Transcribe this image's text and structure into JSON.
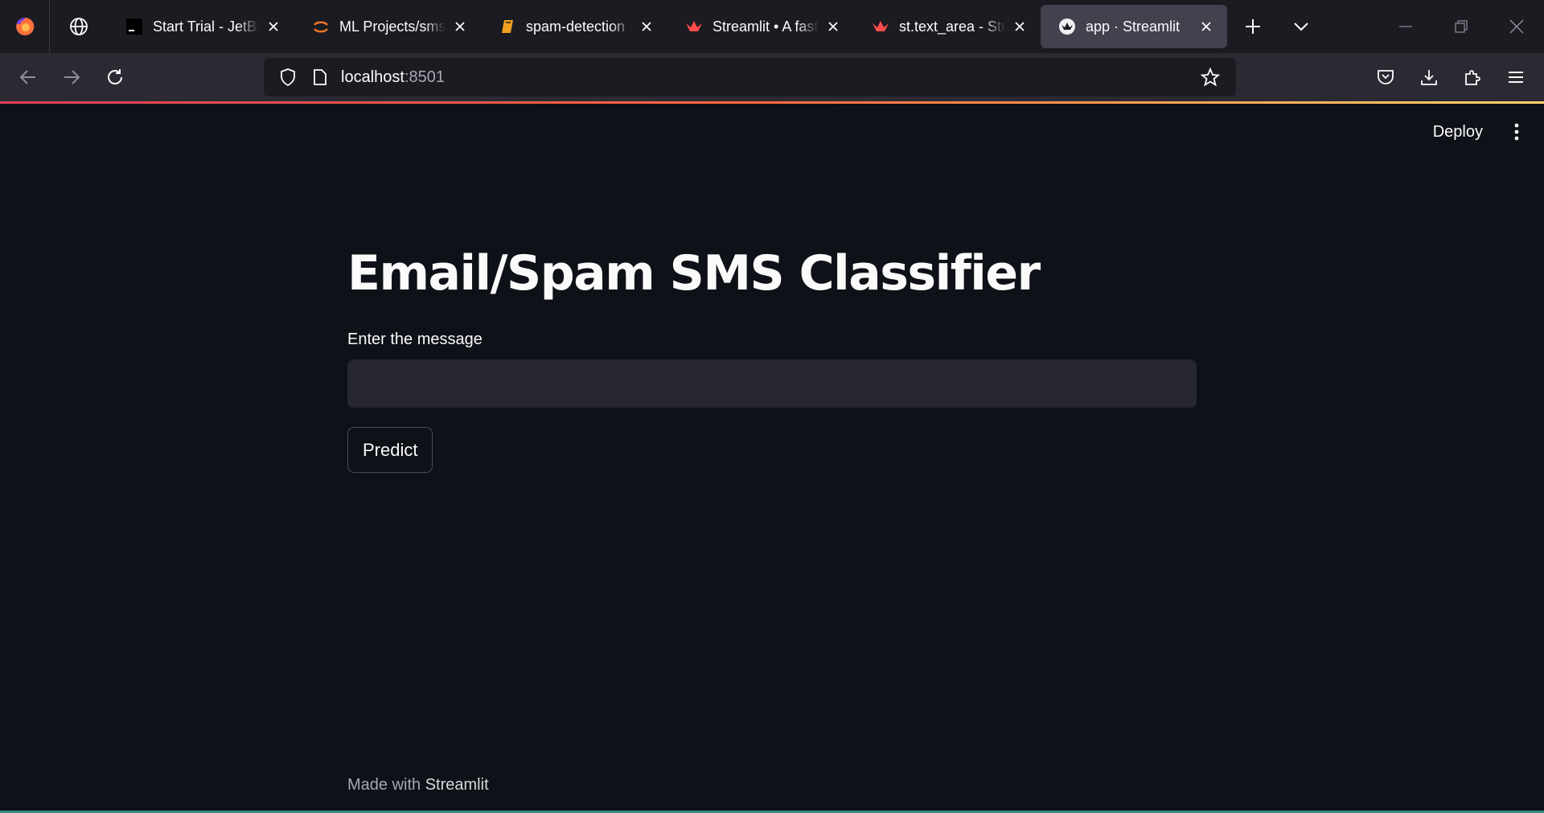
{
  "browser": {
    "tabs": [
      {
        "title": "Start Trial - JetBrains",
        "favicon": "terminal-icon",
        "active": false
      },
      {
        "title": "ML Projects/sms-spam",
        "favicon": "jupyter-icon",
        "active": false
      },
      {
        "title": "spam-detection - ",
        "favicon": "notebook-icon",
        "active": false
      },
      {
        "title": "Streamlit • A faster way",
        "favicon": "streamlit-icon",
        "active": false
      },
      {
        "title": "st.text_area - Streamlit",
        "favicon": "streamlit-icon",
        "active": false
      },
      {
        "title": "app · Streamlit",
        "favicon": "streamlit-icon",
        "active": true
      }
    ],
    "url": {
      "host": "localhost",
      "port": ":8501"
    }
  },
  "app": {
    "deploy_label": "Deploy",
    "title": "Email/Spam SMS Classifier",
    "input_label": "Enter the message",
    "input_value": "",
    "predict_label": "Predict",
    "footer_prefix": "Made with",
    "footer_brand": "Streamlit"
  },
  "colors": {
    "app_bg": "#0e1117",
    "input_bg": "#262730",
    "tabbar_bg": "#1c1b22",
    "navbar_bg": "#2b2a33",
    "streamlit_red": "#ff4b4b"
  }
}
